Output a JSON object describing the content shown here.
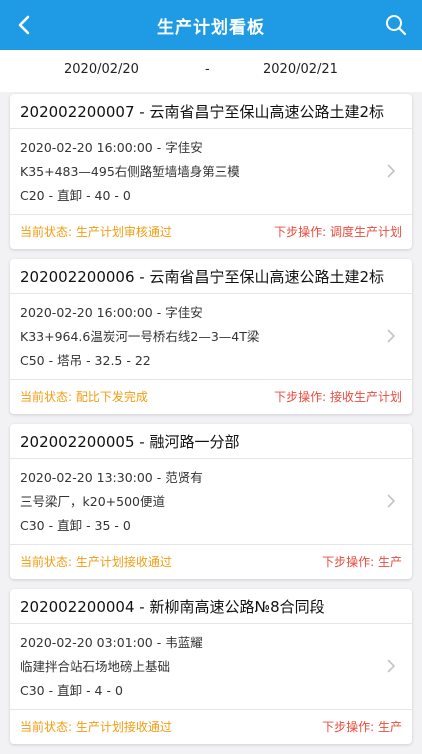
{
  "header": {
    "title": "生产计划看板",
    "back_icon": "back-arrow-icon",
    "search_icon": "search-icon",
    "bg_color": "#1e9be4"
  },
  "date_range": {
    "start": "2020/02/20",
    "separator": "-",
    "end": "2020/02/21"
  },
  "cards": [
    {
      "title": "202002200007 - 云南省昌宁至保山高速公路土建2标",
      "line1": "2020-02-20 16:00:00 - 字佳安",
      "line2": "K35+483—495右侧路堑墙墙身第三模",
      "line3": "C20 - 直卸 - 40 - 0",
      "status": "当前状态: 生产计划审核通过",
      "next": "下步操作: 调度生产计划"
    },
    {
      "title": "202002200006 - 云南省昌宁至保山高速公路土建2标",
      "line1": "2020-02-20 16:00:00 - 字佳安",
      "line2": "K33+964.6温炭河一号桥右线2—3—4T梁",
      "line3": "C50 - 塔吊 - 32.5 - 22",
      "status": "当前状态: 配比下发完成",
      "next": "下步操作: 接收生产计划"
    },
    {
      "title": "202002200005 - 融河路一分部",
      "line1": "2020-02-20 13:30:00 - 范贤有",
      "line2": "三号梁厂，k20+500便道",
      "line3": "C30 - 直卸 - 35 - 0",
      "status": "当前状态: 生产计划接收通过",
      "next": "下步操作: 生产"
    },
    {
      "title": "202002200004 - 新柳南高速公路№8合同段",
      "line1": "2020-02-20 03:01:00 - 韦蓝耀",
      "line2": "临建拌合站石场地磅上基础",
      "line3": "C30 - 直卸 - 4 - 0",
      "status": "当前状态: 生产计划接收通过",
      "next": "下步操作: 生产"
    }
  ]
}
